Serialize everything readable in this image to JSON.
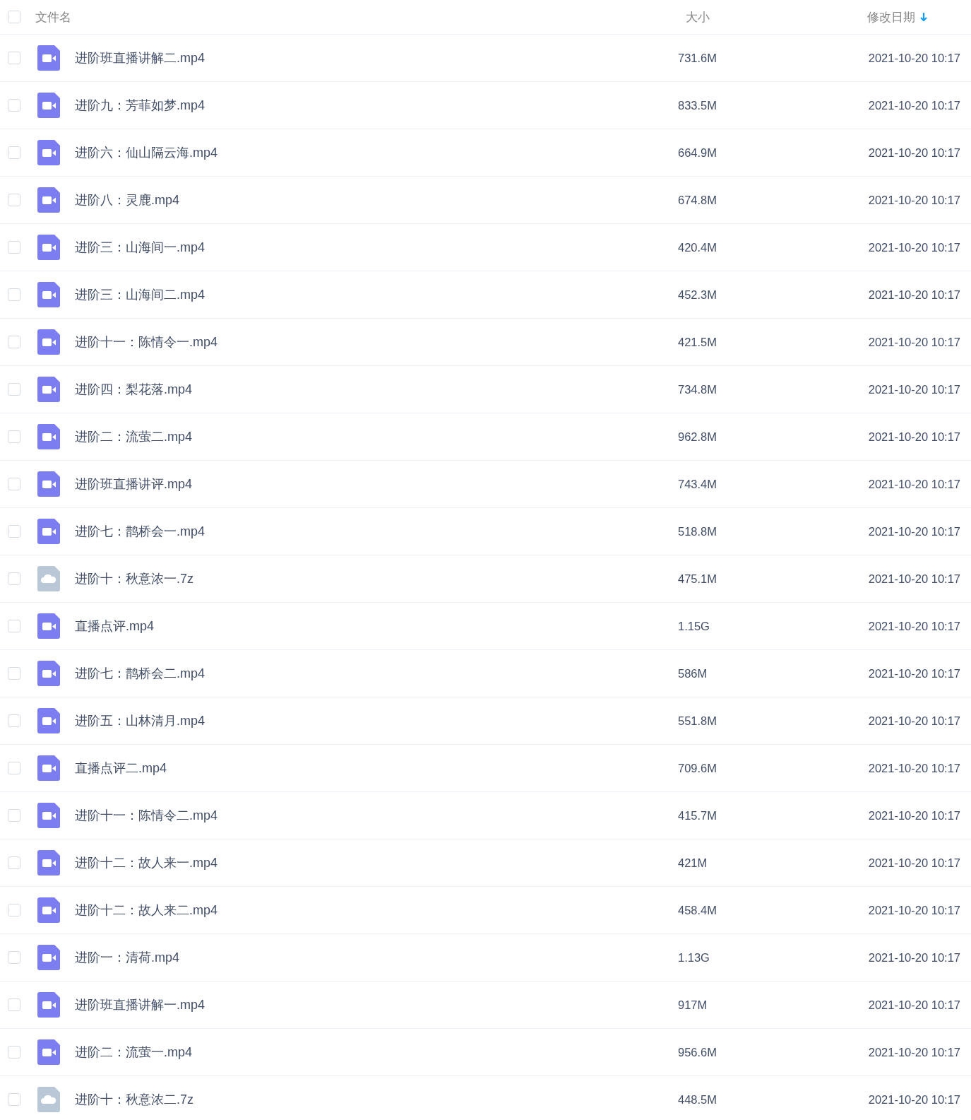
{
  "header": {
    "checked": false,
    "columns": [
      {
        "label": "文件名"
      },
      {
        "label": "大小"
      },
      {
        "label": "修改日期",
        "sorted_descending": true
      }
    ]
  },
  "files": [
    {
      "kind": "video",
      "name": "进阶班直播讲解二.mp4",
      "size": "731.6M",
      "modified": "2021-10-20 10:17",
      "checked": false
    },
    {
      "kind": "video",
      "name": "进阶九：芳菲如梦.mp4",
      "size": "833.5M",
      "modified": "2021-10-20 10:17",
      "checked": false
    },
    {
      "kind": "video",
      "name": "进阶六：仙山隔云海.mp4",
      "size": "664.9M",
      "modified": "2021-10-20 10:17",
      "checked": false
    },
    {
      "kind": "video",
      "name": "进阶八：灵鹿.mp4",
      "size": "674.8M",
      "modified": "2021-10-20 10:17",
      "checked": false
    },
    {
      "kind": "video",
      "name": "进阶三：山海间一.mp4",
      "size": "420.4M",
      "modified": "2021-10-20 10:17",
      "checked": false
    },
    {
      "kind": "video",
      "name": "进阶三：山海间二.mp4",
      "size": "452.3M",
      "modified": "2021-10-20 10:17",
      "checked": false
    },
    {
      "kind": "video",
      "name": "进阶十一：陈情令一.mp4",
      "size": "421.5M",
      "modified": "2021-10-20 10:17",
      "checked": false
    },
    {
      "kind": "video",
      "name": "进阶四：梨花落.mp4",
      "size": "734.8M",
      "modified": "2021-10-20 10:17",
      "checked": false
    },
    {
      "kind": "video",
      "name": "进阶二：流萤二.mp4",
      "size": "962.8M",
      "modified": "2021-10-20 10:17",
      "checked": false
    },
    {
      "kind": "video",
      "name": "进阶班直播讲评.mp4",
      "size": "743.4M",
      "modified": "2021-10-20 10:17",
      "checked": false
    },
    {
      "kind": "video",
      "name": "进阶七：鹊桥会一.mp4",
      "size": "518.8M",
      "modified": "2021-10-20 10:17",
      "checked": false
    },
    {
      "kind": "archive",
      "name": "进阶十：秋意浓一.7z",
      "size": "475.1M",
      "modified": "2021-10-20 10:17",
      "checked": false
    },
    {
      "kind": "video",
      "name": "直播点评.mp4",
      "size": "1.15G",
      "modified": "2021-10-20 10:17",
      "checked": false
    },
    {
      "kind": "video",
      "name": "进阶七：鹊桥会二.mp4",
      "size": "586M",
      "modified": "2021-10-20 10:17",
      "checked": false
    },
    {
      "kind": "video",
      "name": "进阶五：山林清月.mp4",
      "size": "551.8M",
      "modified": "2021-10-20 10:17",
      "checked": false
    },
    {
      "kind": "video",
      "name": "直播点评二.mp4",
      "size": "709.6M",
      "modified": "2021-10-20 10:17",
      "checked": false
    },
    {
      "kind": "video",
      "name": "进阶十一：陈情令二.mp4",
      "size": "415.7M",
      "modified": "2021-10-20 10:17",
      "checked": false
    },
    {
      "kind": "video",
      "name": "进阶十二：故人来一.mp4",
      "size": "421M",
      "modified": "2021-10-20 10:17",
      "checked": false
    },
    {
      "kind": "video",
      "name": "进阶十二：故人来二.mp4",
      "size": "458.4M",
      "modified": "2021-10-20 10:17",
      "checked": false
    },
    {
      "kind": "video",
      "name": "进阶一：清荷.mp4",
      "size": "1.13G",
      "modified": "2021-10-20 10:17",
      "checked": false
    },
    {
      "kind": "video",
      "name": "进阶班直播讲解一.mp4",
      "size": "917M",
      "modified": "2021-10-20 10:17",
      "checked": false
    },
    {
      "kind": "video",
      "name": "进阶二：流萤一.mp4",
      "size": "956.6M",
      "modified": "2021-10-20 10:17",
      "checked": false
    },
    {
      "kind": "archive",
      "name": "进阶十：秋意浓二.7z",
      "size": "448.5M",
      "modified": "2021-10-20 10:17",
      "checked": false
    }
  ]
}
